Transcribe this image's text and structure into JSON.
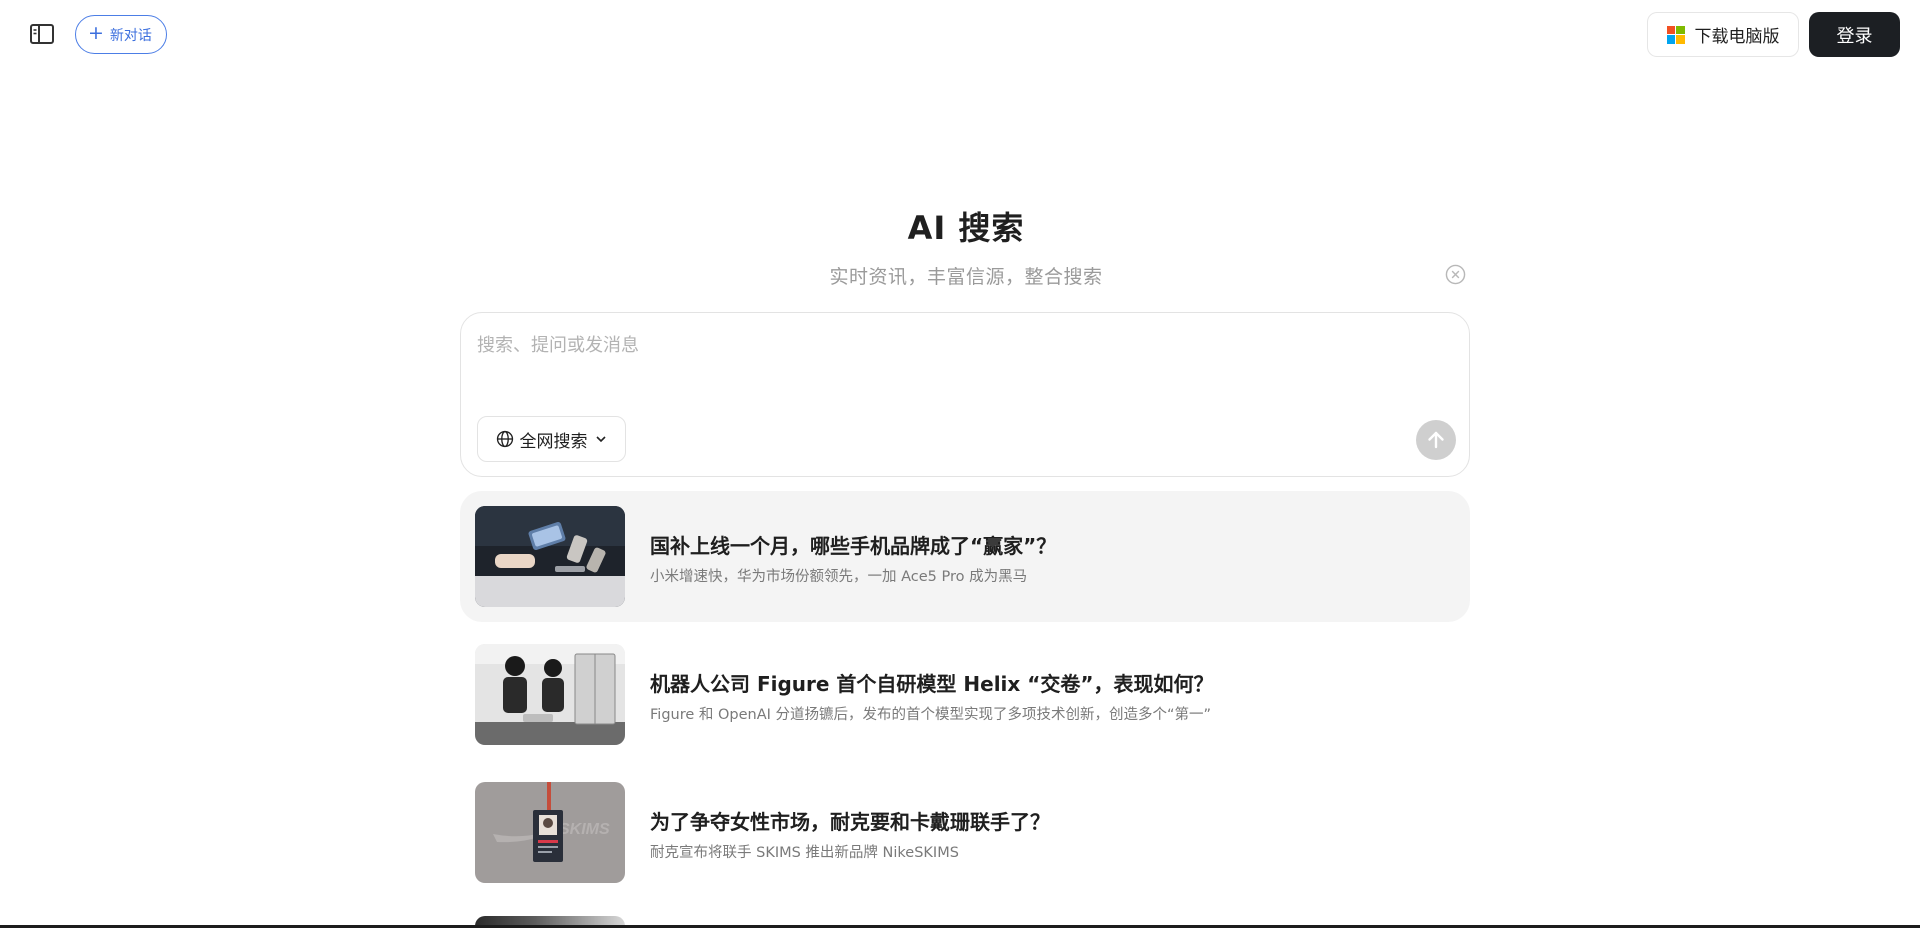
{
  "topbar": {
    "new_chat_label": "新对话",
    "download_label": "下载电脑版",
    "login_label": "登录",
    "ms_logo_colors": [
      "#f25022",
      "#7fba00",
      "#00a4ef",
      "#ffb900"
    ]
  },
  "hero": {
    "title": "AI 搜索",
    "subtitle": "实时资讯，丰富信源，整合搜索"
  },
  "search": {
    "placeholder": "搜索、提问或发消息",
    "scope_label": "全网搜索"
  },
  "news": [
    {
      "title": "国补上线一个月，哪些手机品牌成了“赢家”？",
      "summary": "小米增速快，华为市场份额领先，一加 Ace5 Pro 成为黑马",
      "thumb_icon": "phone-store-photo"
    },
    {
      "title": "机器人公司 Figure 首个自研模型 Helix “交卷”，表现如何？",
      "summary": "Figure 和 OpenAI 分道扬镳后，发布的首个模型实现了多项技术创新，创造多个“第一”",
      "thumb_icon": "humanoid-robot-photo"
    },
    {
      "title": "为了争夺女性市场，耐克要和卡戴珊联手了？",
      "summary": "耐克宣布将联手 SKIMS 推出新品牌 NikeSKIMS",
      "thumb_icon": "lanyard-badge-photo",
      "thumb_badge_text": "SKIMS"
    }
  ],
  "colors": {
    "accent": "#3c6fde",
    "login_bg": "#1c1f23",
    "send_disabled": "#cfcfcf",
    "active_row_bg": "#f4f4f4"
  }
}
